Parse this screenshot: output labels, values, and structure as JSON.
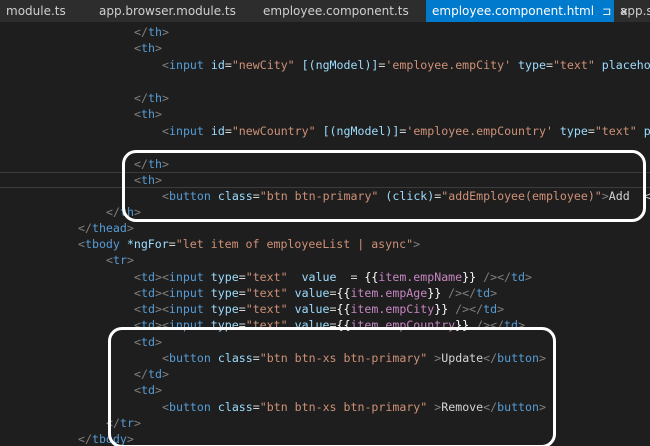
{
  "tabs": [
    {
      "label": "module.ts",
      "active": false
    },
    {
      "label": "app.browser.module.ts",
      "active": false
    },
    {
      "label": "employee.component.ts",
      "active": false
    },
    {
      "label": "employee.component.html",
      "active": true,
      "pin": "⊐",
      "close": "×"
    },
    {
      "label": "app.sha",
      "active": false
    }
  ],
  "code": {
    "l1": {
      "lt": "</",
      "tag": "th",
      "gt": ">"
    },
    "l2": {
      "lt": "<",
      "tag": "th",
      "gt": ">"
    },
    "l3": {
      "lt": "<",
      "tag": "input",
      "a1": " id",
      "eq1": "=",
      "v1": "\"newCity\"",
      "a2": " [(ngModel)]",
      "eq2": "=",
      "v2": "'employee.empCity'",
      "a3": " type",
      "eq3": "=",
      "v3": "\"text\"",
      "a4": " placehol"
    },
    "l5": {
      "lt": "</",
      "tag": "th",
      "gt": ">"
    },
    "l6": {
      "lt": "<",
      "tag": "th",
      "gt": ">"
    },
    "l7": {
      "lt": "<",
      "tag": "input",
      "a1": " id",
      "eq1": "=",
      "v1": "\"newCountry\"",
      "a2": " [(ngModel)]",
      "eq2": "=",
      "v2": "'employee.empCountry'",
      "a3": " type",
      "eq3": "=",
      "v3": "\"text\"",
      "a4": " pla"
    },
    "l9": {
      "lt": "</",
      "tag": "th",
      "gt": ">"
    },
    "l10": {
      "lt": "<",
      "tag": "th",
      "gt": ">"
    },
    "l11": {
      "lt": "<",
      "tag": "button",
      "a1": " class",
      "eq1": "=",
      "v1": "\"btn btn-primary\"",
      "a2": " (click)",
      "eq2": "=",
      "v2": "\"addEmployee(employee)\"",
      "gt": ">",
      "text": "Add  <"
    },
    "l12": {
      "lt": "</",
      "tag": "th",
      "gt": ">"
    },
    "l13": {
      "lt": "</",
      "tag": "thead",
      "gt": ">"
    },
    "l14": {
      "lt": "<",
      "tag": "tbody",
      "a1": " *ngFor",
      "eq1": "=",
      "v1": "\"let item of employeeList | async\"",
      "gt": ">"
    },
    "l15": {
      "lt": "<",
      "tag": "tr",
      "gt": ">"
    },
    "l16": {
      "lt": "<",
      "tag": "td",
      "gt": ">",
      "lt2": "<",
      "tag2": "input",
      "a1": " type",
      "eq1": "=",
      "v1": "\"text\"",
      "a2": "  value  ",
      "eq2": "= ",
      "ob": "{{",
      "mem": "item.empName",
      "cb": "}}",
      "sc": " />",
      "ct": "</",
      "tag3": "td",
      "gt3": ">"
    },
    "l17": {
      "lt": "<",
      "tag": "td",
      "gt": ">",
      "lt2": "<",
      "tag2": "input",
      "a1": " type",
      "eq1": "=",
      "v1": "\"text\"",
      "a2": " value",
      "eq2": "=",
      "ob": "{{",
      "mem": "item.empAge",
      "cb": "}}",
      "sc": " />",
      "ct": "</",
      "tag3": "td",
      "gt3": ">"
    },
    "l18": {
      "lt": "<",
      "tag": "td",
      "gt": ">",
      "lt2": "<",
      "tag2": "input",
      "a1": " type",
      "eq1": "=",
      "v1": "\"text\"",
      "a2": " value",
      "eq2": "=",
      "ob": "{{",
      "mem": "item.empCity",
      "cb": "}}",
      "sc": " />",
      "ct": "</",
      "tag3": "td",
      "gt3": ">"
    },
    "l19": {
      "lt": "<",
      "tag": "td",
      "gt": ">",
      "lt2": "<",
      "tag2": "input",
      "a1": " type",
      "eq1": "=",
      "v1": "\"text\"",
      "a2": " value",
      "eq2": "=",
      "ob": "{{",
      "mem": "item.empCountry",
      "cb": "}}",
      "sc": " />",
      "ct": "</",
      "tag3": "td",
      "gt3": ">"
    },
    "l20": {
      "lt": "<",
      "tag": "td",
      "gt": ">"
    },
    "l21": {
      "lt": "<",
      "tag": "button",
      "a1": " class",
      "eq1": "=",
      "v1": "\"btn btn-xs btn-primary\"",
      "sp": " ",
      "gt": ">",
      "text": "Update",
      "ct": "</",
      "tag2": "button",
      "gt2": ">"
    },
    "l22": {
      "lt": "</",
      "tag": "td",
      "gt": ">"
    },
    "l23": {
      "lt": "<",
      "tag": "td",
      "gt": ">"
    },
    "l24": {
      "lt": "<",
      "tag": "button",
      "a1": " class",
      "eq1": "=",
      "v1": "\"btn btn-xs btn-primary\"",
      "sp": " ",
      "gt": ">",
      "text": "Remove",
      "ct": "</",
      "tag2": "button",
      "gt2": ">"
    },
    "l25": {
      "lt": "</",
      "tag": "tr",
      "gt": ">"
    },
    "l26": {
      "lt": "</",
      "tag": "tbody",
      "gt": ">"
    }
  },
  "colors": {
    "tab_active": "#007acc",
    "editor_bg": "#1e1e1e",
    "tag": "#569cd6",
    "attribute": "#9cdcfe",
    "string": "#ce9178",
    "member": "#c586c0",
    "highlight_box": "#ffffff"
  }
}
